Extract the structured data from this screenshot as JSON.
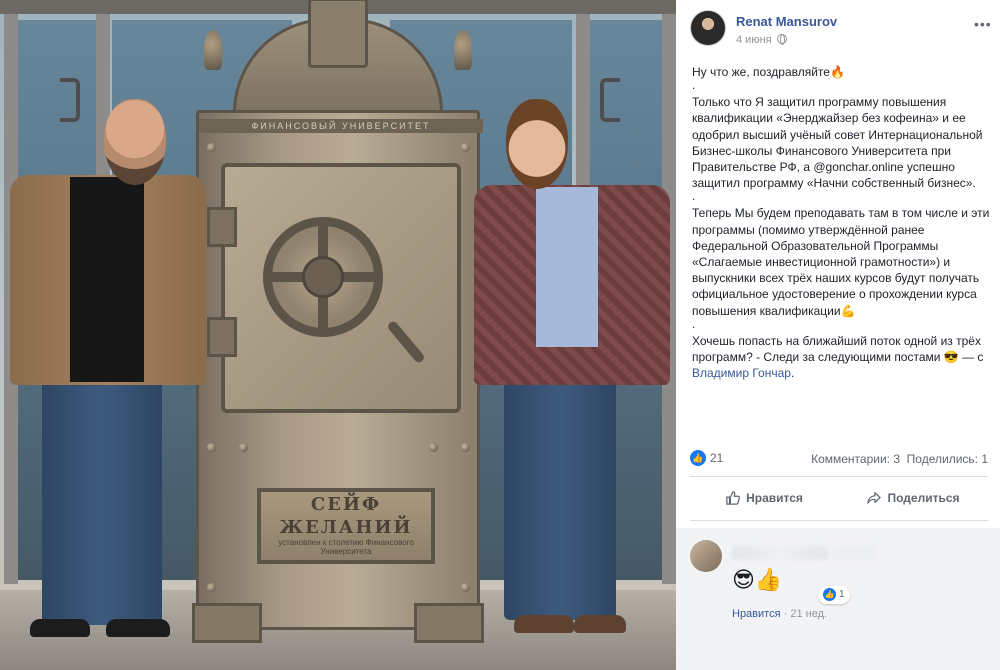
{
  "photo": {
    "safe_band_text": "ФИНАНСОВЫЙ УНИВЕРСИТЕТ",
    "plaque_line1": "СЕЙФ",
    "plaque_line2": "ЖЕЛАНИЙ",
    "plaque_small": "установлен к столетию Финансового Университета"
  },
  "post": {
    "author": "Renat Mansurov",
    "date": "4 июня",
    "more_icon": "ellipsis-icon",
    "privacy_icon": "globe-icon",
    "paragraphs": {
      "p1": "Ну что же, поздравляйте🔥",
      "dot1": ".",
      "p2": "Только что Я защитил программу повышения квалификации «Энерджайзер без кофеина» и ее одобрил высший учёный совет Интернациональной Бизнес-школы Финансового Университета при Правительстве РФ, а @gonchar.online успешно защитил программу «Начни собственный бизнес».",
      "dot2": ".",
      "p3": "Теперь Мы будем преподавать там в том числе и эти программы (помимо утверждённой ранее Федеральной Образовательной Программы «Слагаемые инвестиционной грамотности») и выпускники всех трёх наших курсов будут получать официальное удостоверение о прохождении курса повышения квалификации💪",
      "dot3": ".",
      "p4": "Хочешь попасть на ближайший поток одной из трёх программ? - Следи за следующими постами 😎",
      "with_prefix": " — с ",
      "tagged": "Владимир Гончар",
      "with_suffix": "."
    },
    "reactions": {
      "like_icon": "thumbs-up-icon",
      "count": "21",
      "comments": "Комментарии: 3",
      "shares": "Поделились: 1"
    },
    "actions": {
      "like": "Нравится",
      "share": "Поделиться"
    },
    "comment": {
      "emoji": "😎👍",
      "like_count": "1",
      "like_link": "Нравится",
      "separator": " · ",
      "time": "21 нед."
    }
  }
}
